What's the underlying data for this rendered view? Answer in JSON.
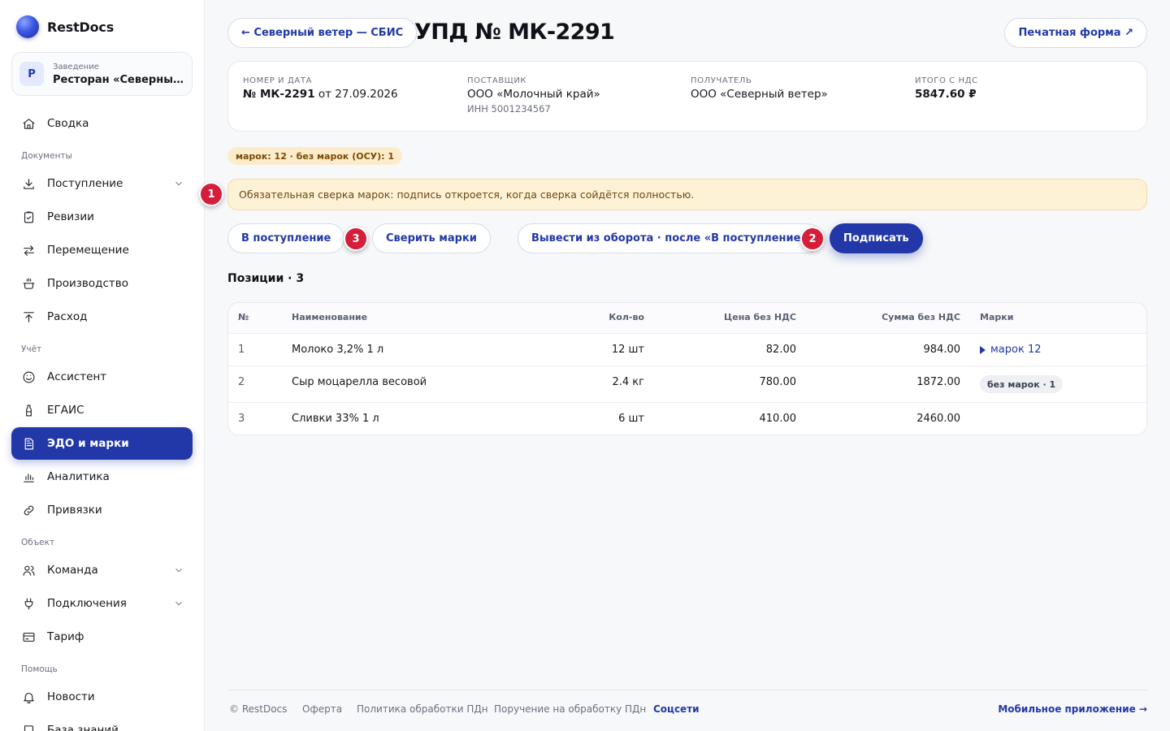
{
  "brand": {
    "name": "RestDocs"
  },
  "venue": {
    "avatar": "Р",
    "label": "Заведение",
    "name": "Ресторан «Северный ..."
  },
  "sidebar": {
    "items": [
      {
        "label": "Сводка"
      },
      {
        "label": "Поступление"
      },
      {
        "label": "Ревизии"
      },
      {
        "label": "Перемещение"
      },
      {
        "label": "Производство"
      },
      {
        "label": "Расход"
      },
      {
        "label": "Ассистент"
      },
      {
        "label": "ЕГАИС"
      },
      {
        "label": "ЭДО и марки"
      },
      {
        "label": "Аналитика"
      },
      {
        "label": "Привязки"
      },
      {
        "label": "Команда"
      },
      {
        "label": "Подключения"
      },
      {
        "label": "Тариф"
      },
      {
        "label": "Новости"
      },
      {
        "label": "База знаний"
      }
    ],
    "sections": [
      "Документы",
      "Учёт",
      "Объект",
      "Помощь"
    ]
  },
  "header": {
    "back_label": "← Северный ветер — СБИС",
    "title": "УПД № МК-2291",
    "print_label": "Печатная форма ↗"
  },
  "summary": {
    "number_label": "Номер и дата",
    "number": "№ МК-2291",
    "date_text": "от 27.09.2026",
    "supplier_label": "Поставщик",
    "supplier": "ООО «Молочный край»",
    "supplier_inn": "ИНН 5001234567",
    "recipient_label": "Получатель",
    "recipient": "ООО «Северный ветер»",
    "total_label": "Итого с НДС",
    "total": "5847.60 ₽"
  },
  "marks_badge": "марок: 12 · без марок (ОСУ): 1",
  "alert": "Обязательная сверка марок: подпись откроется, когда сверка сойдётся полностью.",
  "actions": {
    "to_receipt": "В поступление",
    "check_marks": "Сверить марки",
    "withdraw": "Вывести из оборота · после «В поступление»",
    "sign": "Подписать"
  },
  "steps": [
    "1",
    "2",
    "3"
  ],
  "positions": {
    "title": "Позиции · 3",
    "columns": [
      "№",
      "Наименование",
      "Кол-во",
      "Цена без НДС",
      "Сумма без НДС",
      "Марки"
    ],
    "rows": [
      {
        "n": "1",
        "name": "Молоко 3,2% 1 л",
        "qty": "12 шт",
        "price": "82.00",
        "sum": "984.00",
        "marks": "марок 12"
      },
      {
        "n": "2",
        "name": "Сыр моцарелла весовой",
        "qty": "2.4 кг",
        "price": "780.00",
        "sum": "1872.00",
        "marks": "без марок · 1"
      },
      {
        "n": "3",
        "name": "Сливки 33% 1 л",
        "qty": "6 шт",
        "price": "410.00",
        "sum": "2460.00",
        "marks": ""
      }
    ]
  },
  "footer": {
    "copyright": "© RestDocs",
    "offer": "Оферта",
    "privacy": "Политика обработки ПДн",
    "processing": "Поручение на обработку ПДн",
    "social": "Соцсети",
    "mobile": "Мобильное приложение →"
  },
  "colors": {
    "accent": "#2238a8",
    "step": "#d51f3a",
    "alert_bg": "#fdf1d6",
    "badge_bg": "#fdeccb"
  }
}
